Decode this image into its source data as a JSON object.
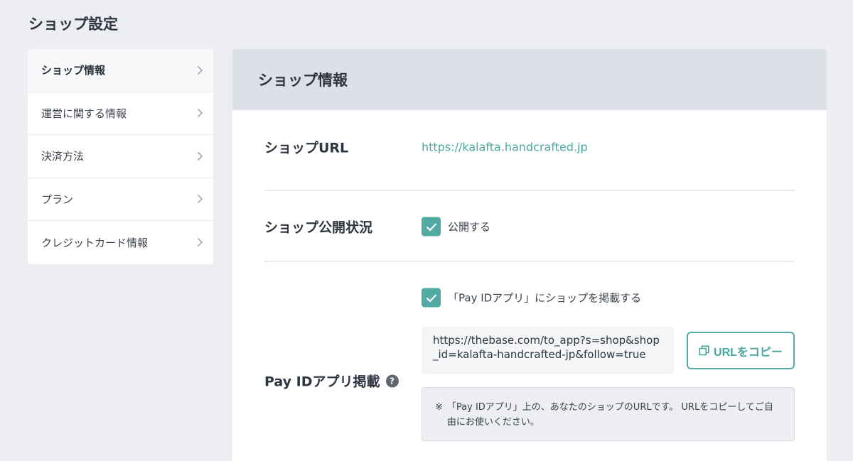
{
  "page": {
    "title": "ショップ設定"
  },
  "sidebar": {
    "items": [
      {
        "label": "ショップ情報",
        "active": true
      },
      {
        "label": "運営に関する情報"
      },
      {
        "label": "決済方法"
      },
      {
        "label": "プラン"
      },
      {
        "label": "クレジットカード情報"
      }
    ]
  },
  "panel": {
    "title": "ショップ情報",
    "shop_url": {
      "label": "ショップURL",
      "value": "https://kalafta.handcrafted.jp"
    },
    "publish_status": {
      "label": "ショップ公開状況",
      "checkbox_label": "公開する",
      "checked": true
    },
    "payid": {
      "label": "Pay IDアプリ掲載",
      "help_icon": "?",
      "checkbox_label": "「Pay IDアプリ」にショップを掲載する",
      "checked": true,
      "url": "https://thebase.com/to_app?s=shop&shop_id=kalafta-handcrafted-jp&follow=true",
      "copy_button": "URLをコピー",
      "note_mark": "※",
      "note": "「Pay IDアプリ」上の、あなたのショップのURLです。 URLをコピーしてご自由にお使いください。"
    }
  },
  "colors": {
    "accent": "#52aba3",
    "link": "#4aa79f",
    "background": "#eceef2",
    "header_bg": "#dde1e7"
  }
}
